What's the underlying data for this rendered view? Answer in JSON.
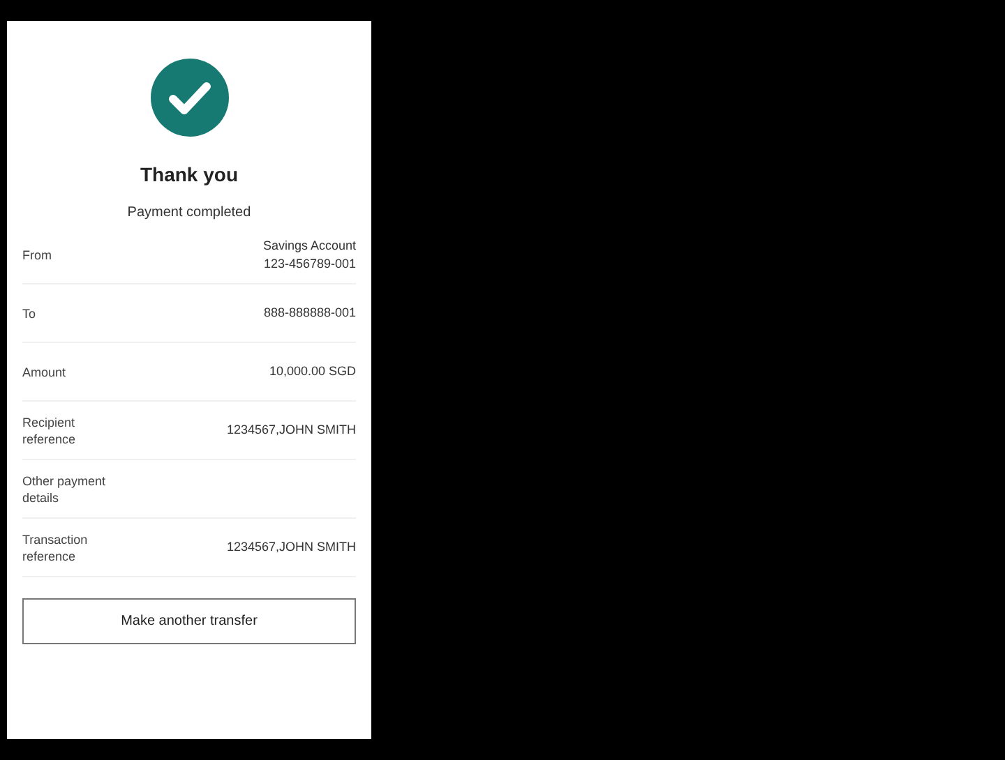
{
  "title": "Thank you",
  "subtitle": "Payment completed",
  "details": [
    {
      "label": "From",
      "value": [
        "Savings Account",
        "123-456789-001"
      ]
    },
    {
      "label": "To",
      "value": [
        "888-888888-001"
      ]
    },
    {
      "label": "Amount",
      "value": [
        "10,000.00 SGD"
      ]
    },
    {
      "label": "Recipient reference",
      "value": [
        "1234567,JOHN SMITH"
      ]
    },
    {
      "label": "Other payment details"
    },
    {
      "label": "Transaction reference",
      "value": [
        "1234567,JOHN SMITH"
      ]
    }
  ],
  "button": "Make another transfer"
}
